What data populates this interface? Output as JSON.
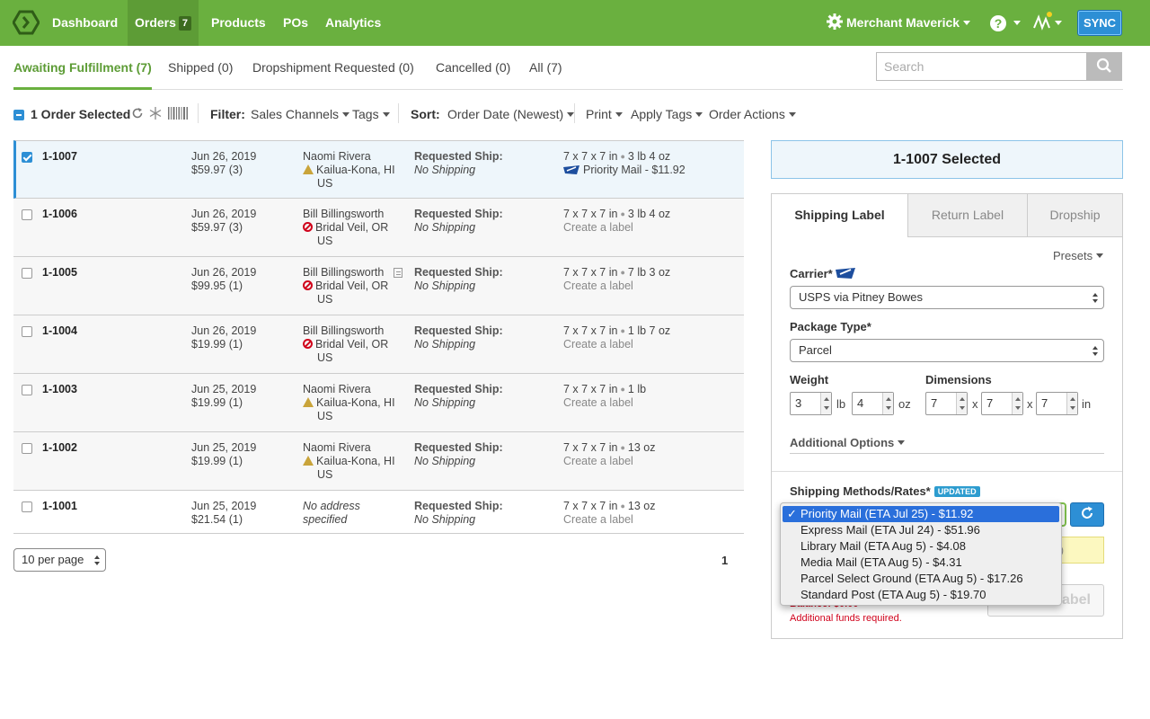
{
  "nav": {
    "items": [
      "Dashboard",
      "Orders",
      "Products",
      "POs",
      "Analytics"
    ],
    "orders_badge": "7",
    "merchant": "Merchant Maverick",
    "help": "?",
    "sync": "SYNC"
  },
  "tabs": [
    "Awaiting Fulfillment (7)",
    "Shipped (0)",
    "Dropshipment Requested (0)",
    "Cancelled (0)",
    "All (7)"
  ],
  "search": {
    "placeholder": "Search"
  },
  "toolbar": {
    "selected": "1 Order Selected",
    "filter_label": "Filter:",
    "sales_channels": "Sales Channels",
    "tags": "Tags",
    "sort_label": "Sort:",
    "sort_value": "Order Date (Newest)",
    "print": "Print",
    "apply_tags": "Apply Tags",
    "order_actions": "Order Actions"
  },
  "orders": [
    {
      "id": "1-1007",
      "date": "Jun 26, 2019",
      "total": "$59.97 (3)",
      "name": "Naomi Rivera",
      "city": "Kailua-Kona, HI",
      "country": "US",
      "req_label": "Requested Ship:",
      "req_value": "No Shipping",
      "dims": "7 x 7 x 7 in",
      "weight": "3 lb 4 oz",
      "label": "Priority Mail - $11.92"
    },
    {
      "id": "1-1006",
      "date": "Jun 26, 2019",
      "total": "$59.97 (3)",
      "name": "Bill Billingsworth",
      "city": "Bridal Veil, OR",
      "country": "US",
      "req_label": "Requested Ship:",
      "req_value": "No Shipping",
      "dims": "7 x 7 x 7 in",
      "weight": "3 lb 4 oz",
      "label": "Create a label"
    },
    {
      "id": "1-1005",
      "date": "Jun 26, 2019",
      "total": "$99.95 (1)",
      "name": "Bill Billingsworth",
      "city": "Bridal Veil, OR",
      "country": "US",
      "req_label": "Requested Ship:",
      "req_value": "No Shipping",
      "dims": "7 x 7 x 7 in",
      "weight": "7 lb 3 oz",
      "label": "Create a label"
    },
    {
      "id": "1-1004",
      "date": "Jun 26, 2019",
      "total": "$19.99 (1)",
      "name": "Bill Billingsworth",
      "city": "Bridal Veil, OR",
      "country": "US",
      "req_label": "Requested Ship:",
      "req_value": "No Shipping",
      "dims": "7 x 7 x 7 in",
      "weight": "1 lb 7 oz",
      "label": "Create a label"
    },
    {
      "id": "1-1003",
      "date": "Jun 25, 2019",
      "total": "$19.99 (1)",
      "name": "Naomi Rivera",
      "city": "Kailua-Kona, HI",
      "country": "US",
      "req_label": "Requested Ship:",
      "req_value": "No Shipping",
      "dims": "7 x 7 x 7 in",
      "weight": "1 lb",
      "label": "Create a label"
    },
    {
      "id": "1-1002",
      "date": "Jun 25, 2019",
      "total": "$19.99 (1)",
      "name": "Naomi Rivera",
      "city": "Kailua-Kona, HI",
      "country": "US",
      "req_label": "Requested Ship:",
      "req_value": "No Shipping",
      "dims": "7 x 7 x 7 in",
      "weight": "13 oz",
      "label": "Create a label"
    },
    {
      "id": "1-1001",
      "date": "Jun 25, 2019",
      "total": "$21.54 (1)",
      "address1": "No address",
      "address2": "specified",
      "req_label": "Requested Ship:",
      "req_value": "No Shipping",
      "dims": "7 x 7 x 7 in",
      "weight": "13 oz",
      "label": "Create a label"
    }
  ],
  "pagination": {
    "per_page": "10 per page",
    "page": "1"
  },
  "panel": {
    "selected_title": "1-1007 Selected",
    "tabs": [
      "Shipping Label",
      "Return Label",
      "Dropship"
    ],
    "presets": "Presets",
    "carrier_label": "Carrier*",
    "carrier_value": "USPS via Pitney Bowes",
    "package_label": "Package Type*",
    "package_value": "Parcel",
    "weight_label": "Weight",
    "weight_lb": "3",
    "lb": "lb",
    "weight_oz": "4",
    "oz": "oz",
    "dimensions_label": "Dimensions",
    "dim_l": "7",
    "dim_w": "7",
    "dim_h": "7",
    "x": "x",
    "in": "in",
    "additional_options": "Additional Options",
    "methods_label": "Shipping Methods/Rates*",
    "updated_badge": "UPDATED",
    "yellow_note_tail": ")",
    "balance": "Balance: $0.00",
    "funds": "Additional funds required.",
    "buy_label_tail": "abel"
  },
  "dropdown": {
    "check": "✓",
    "options": [
      "Priority Mail (ETA Jul 25) - $11.92",
      "Express Mail (ETA Jul 24) - $51.96",
      "Library Mail (ETA Aug 5) - $4.08",
      "Media Mail (ETA Aug 5) - $4.31",
      "Parcel Select Ground (ETA Aug 5) - $17.26",
      "Standard Post (ETA Aug 5) - $19.70"
    ]
  },
  "colors": {
    "brand_green": "#6ab03f",
    "accent_blue": "#2d8fd5",
    "error_red": "#d0021b",
    "warn_gold": "#c9a43a"
  }
}
